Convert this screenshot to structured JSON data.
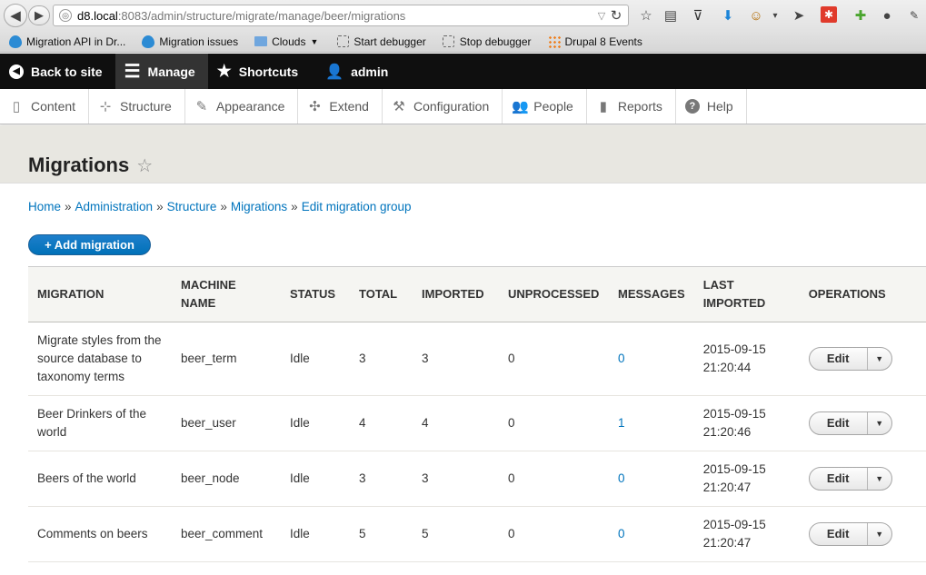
{
  "browser": {
    "url_host": "d8.local",
    "url_path": ":8083/admin/structure/migrate/manage/beer/migrations",
    "bookmarks": [
      {
        "label": "Migration API in Dr...",
        "icon": "drupal-drop-icon"
      },
      {
        "label": "Migration issues",
        "icon": "drupal-drop-icon"
      },
      {
        "label": "Clouds",
        "icon": "folder-icon"
      },
      {
        "label": "Start debugger",
        "icon": "bookmarklet-icon"
      },
      {
        "label": "Stop debugger",
        "icon": "bookmarklet-icon"
      },
      {
        "label": "Drupal 8 Events",
        "icon": "dotted-grid-icon"
      }
    ]
  },
  "toolbar": {
    "back_to_site": "Back to site",
    "manage": "Manage",
    "shortcuts": "Shortcuts",
    "user": "admin"
  },
  "tray": [
    {
      "label": "Content",
      "icon": "content-icon",
      "glyph": "▯"
    },
    {
      "label": "Structure",
      "icon": "structure-icon",
      "glyph": "⊹"
    },
    {
      "label": "Appearance",
      "icon": "appearance-icon",
      "glyph": "✎"
    },
    {
      "label": "Extend",
      "icon": "extend-icon",
      "glyph": "✣"
    },
    {
      "label": "Configuration",
      "icon": "configuration-icon",
      "glyph": "🔧"
    },
    {
      "label": "People",
      "icon": "people-icon",
      "glyph": "👥"
    },
    {
      "label": "Reports",
      "icon": "reports-icon",
      "glyph": "▮"
    },
    {
      "label": "Help",
      "icon": "help-icon",
      "glyph": "?"
    }
  ],
  "page": {
    "title": "Migrations",
    "breadcrumb": [
      "Home",
      "Administration",
      "Structure",
      "Migrations",
      "Edit migration group"
    ],
    "add_button": "+ Add migration"
  },
  "table": {
    "headers": [
      "MIGRATION",
      "MACHINE NAME",
      "STATUS",
      "TOTAL",
      "IMPORTED",
      "UNPROCESSED",
      "MESSAGES",
      "LAST IMPORTED",
      "OPERATIONS"
    ],
    "rows": [
      {
        "migration": "Migrate styles from the source database to taxonomy terms",
        "machine_name": "beer_term",
        "status": "Idle",
        "total": "3",
        "imported": "3",
        "unprocessed": "0",
        "messages": "0",
        "last_imported": "2015-09-15 21:20:44",
        "op": "Edit"
      },
      {
        "migration": "Beer Drinkers of the world",
        "machine_name": "beer_user",
        "status": "Idle",
        "total": "4",
        "imported": "4",
        "unprocessed": "0",
        "messages": "1",
        "last_imported": "2015-09-15 21:20:46",
        "op": "Edit"
      },
      {
        "migration": "Beers of the world",
        "machine_name": "beer_node",
        "status": "Idle",
        "total": "3",
        "imported": "3",
        "unprocessed": "0",
        "messages": "0",
        "last_imported": "2015-09-15 21:20:47",
        "op": "Edit"
      },
      {
        "migration": "Comments on beers",
        "machine_name": "beer_comment",
        "status": "Idle",
        "total": "5",
        "imported": "5",
        "unprocessed": "0",
        "messages": "0",
        "last_imported": "2015-09-15 21:20:47",
        "op": "Edit"
      }
    ]
  },
  "colors": {
    "link": "#0074bd",
    "toolbar": "#0f0f0f",
    "button": "#0071b8"
  }
}
